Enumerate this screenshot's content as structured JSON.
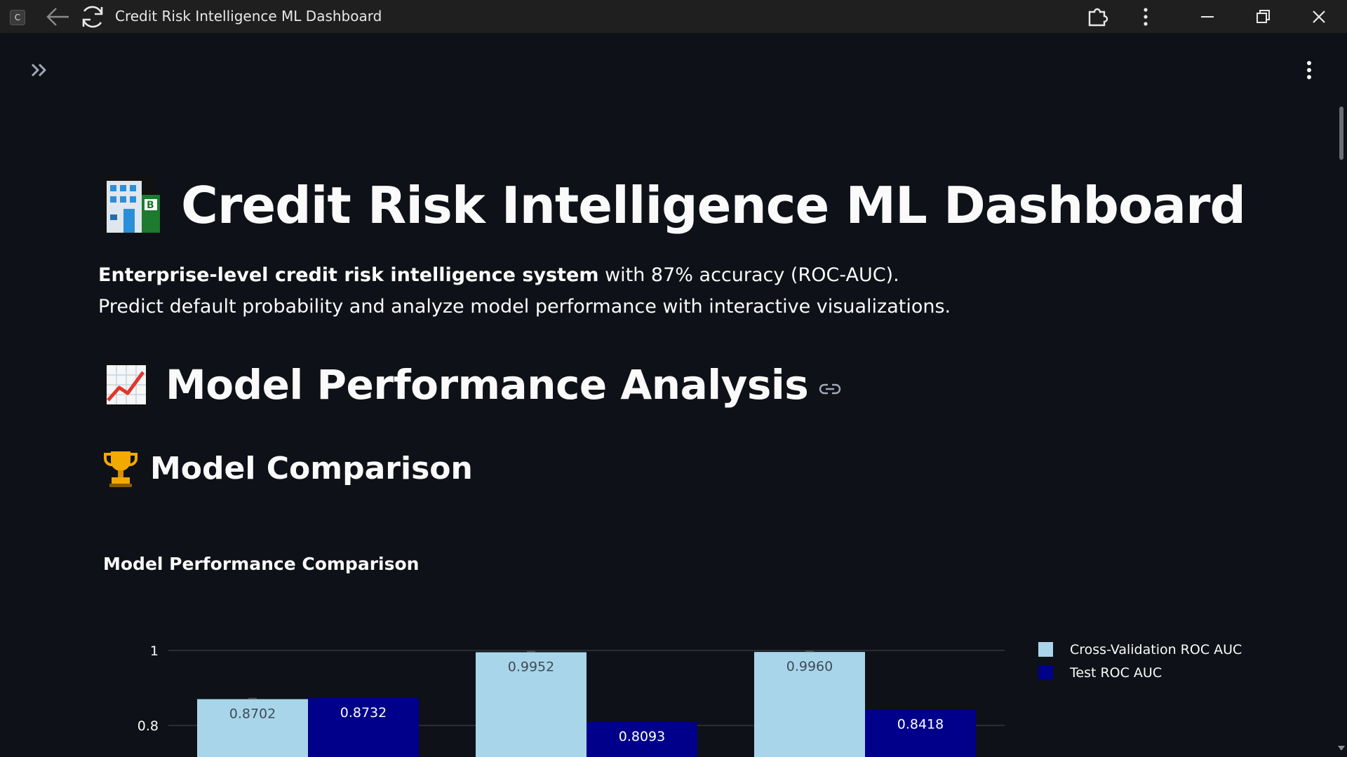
{
  "window": {
    "app_icon_letter": "C",
    "title": "Credit Risk Intelligence ML Dashboard"
  },
  "icons": {
    "back": "arrow-left-icon",
    "reload": "reload-icon",
    "extensions": "puzzle-icon",
    "more": "more-vertical-icon",
    "minimize": "minimize-icon",
    "maximize": "restore-icon",
    "close": "close-icon",
    "sidebar": "double-chevron-right-icon",
    "main_menu": "more-vertical-icon",
    "anchor": "link-icon"
  },
  "header": {
    "title_emoji": "office-building-icon",
    "title": "Credit Risk Intelligence ML Dashboard",
    "intro_bold": "Enterprise-level credit risk intelligence system",
    "intro_rest": " with 87% accuracy (ROC-AUC).",
    "intro_line2": "Predict default probability and analyze model performance with interactive visualizations."
  },
  "section": {
    "emoji": "chart-increasing-icon",
    "title": "Model Performance Analysis"
  },
  "subsection": {
    "emoji": "trophy-icon",
    "title": "Model Comparison"
  },
  "colors": {
    "background": "#0e1117",
    "cv_color": "#a8d5ea",
    "test_color": "#00008b",
    "text": "#fafafa"
  },
  "chart_data": {
    "type": "bar",
    "title": "Model Performance Comparison",
    "categories": [
      "",
      "",
      ""
    ],
    "series": [
      {
        "name": "Cross-Validation ROC AUC",
        "values": [
          0.8702,
          0.9952,
          0.996
        ],
        "labels": [
          "0.8702",
          "0.9952",
          "0.9960"
        ]
      },
      {
        "name": "Test ROC AUC",
        "values": [
          0.8732,
          0.8093,
          0.8418
        ],
        "labels": [
          "0.8732",
          "0.8093",
          "0.8418"
        ]
      }
    ],
    "y_ticks": [
      "1",
      "0.8"
    ],
    "ylim_visible": [
      0.8,
      1.0
    ],
    "grid": true,
    "legend_placement": "top-right"
  }
}
